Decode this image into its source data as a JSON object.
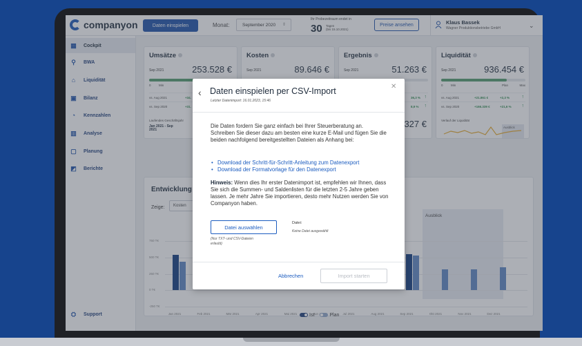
{
  "header": {
    "logo_text": "companyon",
    "import_button": "Daten einspielen",
    "month_label": "Monat:",
    "month_value": "September 2020",
    "trial_text": "Ihr Probezeitraum endet in",
    "trial_days": "30",
    "trial_days_unit": "Tagen",
    "trial_until": "(bis 15.10.2021)",
    "prices_button": "Preise ansehen",
    "user_name": "Klaus Bassek",
    "user_company": "Wagner Produktionsbetriebe GmbH"
  },
  "sidebar": {
    "items": [
      {
        "label": "Cockpit",
        "icon": "dashboard-icon"
      },
      {
        "label": "BWA",
        "icon": "search-icon"
      },
      {
        "label": "Liquidität",
        "icon": "bank-icon"
      },
      {
        "label": "Bilanz",
        "icon": "balance-icon"
      },
      {
        "label": "Kennzahlen",
        "icon": "gauge-icon"
      },
      {
        "label": "Analyse",
        "icon": "analysis-icon"
      },
      {
        "label": "Planung",
        "icon": "book-icon"
      },
      {
        "label": "Berichte",
        "icon": "report-icon"
      }
    ],
    "support_label": "Support"
  },
  "cards": [
    {
      "title": "Umsätze",
      "period": "Sep 2021",
      "value": "253.528 €",
      "scale_left": "0",
      "scale_mid": "Min",
      "rows": [
        {
          "label": "vs. Aug 2021",
          "value": "+34."
        },
        {
          "label": "vs. Sep 2020",
          "value": "+31."
        }
      ],
      "lower_label": "Laufendes Geschäftsjahr",
      "lower_period": "Jan 2021 - Sep 2021",
      "lower_period2": "vs. Jan 2020 - Sep 2020",
      "lower_value": "+1"
    },
    {
      "title": "Kosten",
      "period": "Sep 2021",
      "value": "89.646 €"
    },
    {
      "title": "Ergebnis",
      "period": "Sep 2021",
      "value": "51.263 €",
      "rows": [
        {
          "pct": "36,3 %"
        },
        {
          "pct": "8,9 %"
        }
      ],
      "lower_value": "327 €",
      "lower_scale": "Min  Plan",
      "lower_pct": "6,0 %"
    },
    {
      "title": "Liquidität",
      "period": "Sep 2021",
      "value": "936.454 €",
      "scale_left": "0",
      "scale_mid": "Min",
      "scale_plan": "Plan",
      "scale_max": "Max",
      "rows": [
        {
          "label": "vs. Aug 2021",
          "value": "+21.861 €",
          "pct": "+2,3 %"
        },
        {
          "label": "vs. Sep 2020",
          "value": "+166.339 €",
          "pct": "+21,6 %"
        }
      ],
      "lower_label": "Verlauf der Liquidität",
      "ausblick": "Ausblick",
      "months": [
        "Jan",
        "Mär",
        "Mai",
        "Jul",
        "Sep",
        "Nov"
      ]
    }
  ],
  "panel": {
    "title": "Entwicklung in",
    "show_label": "Zeige:",
    "show_value": "Kosten",
    "ausblick_label": "Ausblick",
    "y_ticks": [
      "750 T€",
      "500 T€",
      "250 T€",
      "0 T€",
      "-250 T€"
    ],
    "months": [
      "Jan 2021",
      "Feb 2021",
      "Mär 2021",
      "Apr 2021",
      "Mai 2021",
      "Jun 2021",
      "Jul 2021",
      "Aug 2021",
      "Sep 2021",
      "Okt 2021",
      "Nov 2021",
      "Dez 2021"
    ],
    "legend_ist": "Ist",
    "legend_plan": "Plan"
  },
  "modal": {
    "title": "Daten einspielen per CSV-Import",
    "last_import": "Letzter Datenimport: 16.01.2023, 15:46",
    "intro": "Die Daten fordern Sie ganz einfach bei Ihrer Steuerberatung an. Schreiben Sie dieser dazu am besten eine kurze E-Mail und fügen Sie die beiden nachfolgend bereitgestellten Dateien als Anhang bei:",
    "link1": "Download der Schritt-für-Schritt-Anleitung zum Datenexport",
    "link2": "Download der Formatvorlage für den Datenexport",
    "hint_label": "Hinweis:",
    "hint_text": " Wenn dies Ihr erster Datenimport ist, empfehlen wir Ihnen, dass Sie sich die Summen- und Saldenlisten für die letzten 2-5 Jahre geben lassen. Je mehr Jahre Sie importieren, desto mehr Nutzen werden Sie von Companyon haben.",
    "choose_file": "Datei auswählen",
    "file_types": "(Nur TXT- und CSV-Dateien erlaubt)",
    "file_label": "Datei:",
    "file_status": "Keine Datei ausgewählt",
    "cancel": "Abbrechen",
    "start": "Import starten"
  },
  "colors": {
    "background": "#17448d",
    "primary": "#1a4fa8",
    "link": "#1a5bbf",
    "bar_ist": "#0d3a7e",
    "bar_plan": "#5b86c4",
    "positive": "#2e8b4e"
  }
}
